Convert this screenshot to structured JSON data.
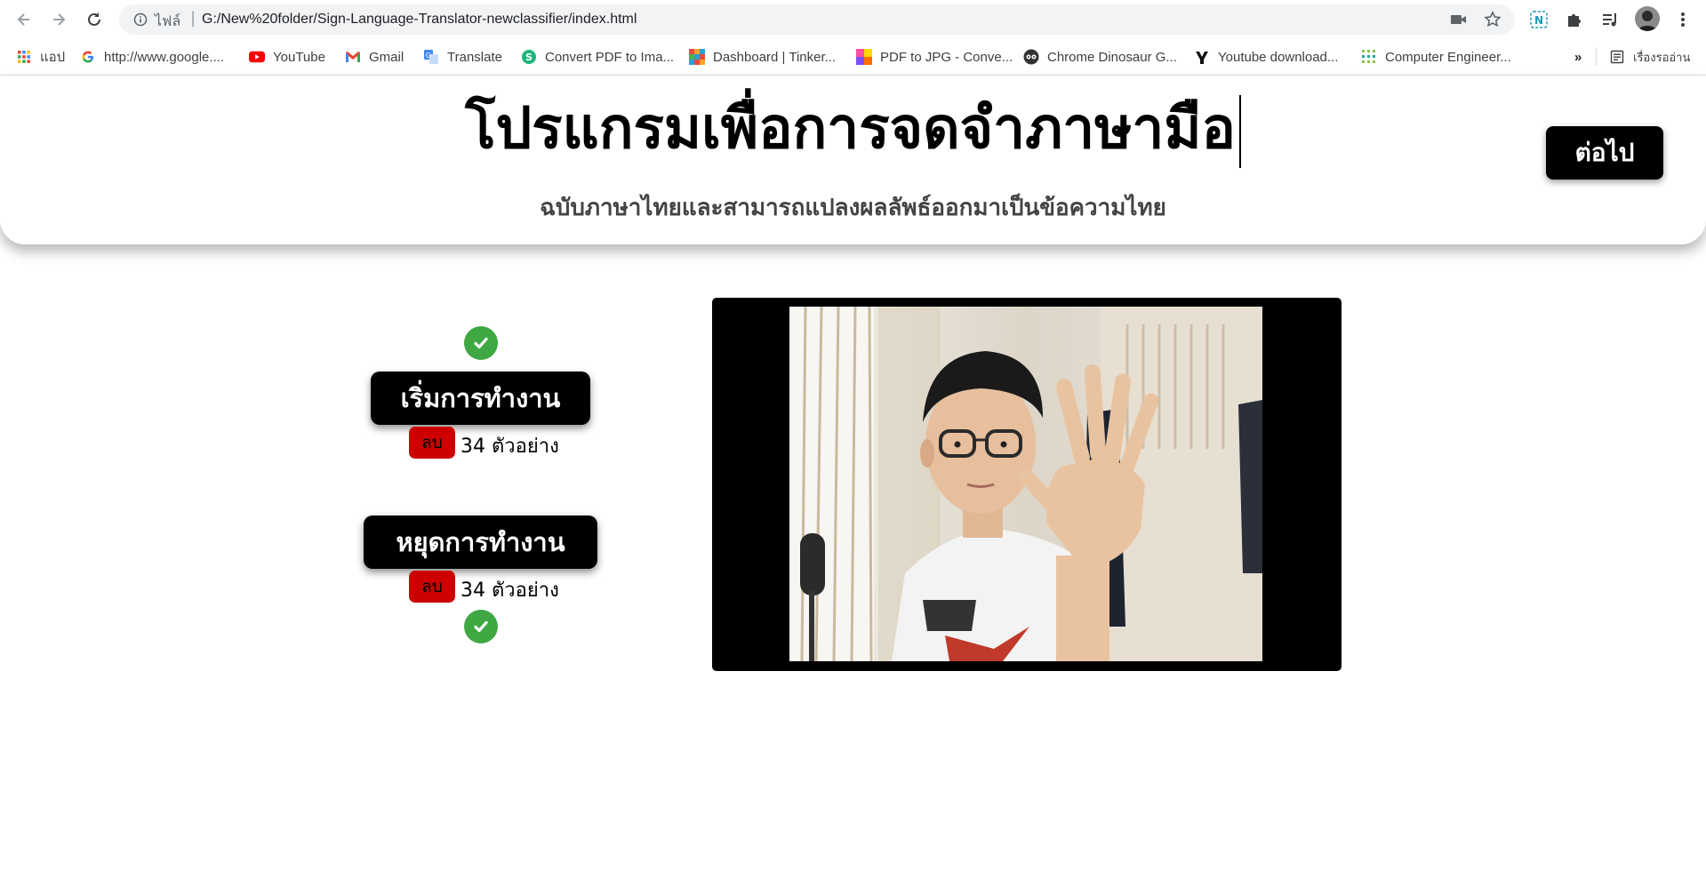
{
  "browser": {
    "scheme_label": "ไฟล์",
    "url": "G:/New%20folder/Sign-Language-Translator-newclassifier/index.html",
    "bookmarks": [
      {
        "label": "แอป",
        "icon": "apps-grid-icon"
      },
      {
        "label": "http://www.google....",
        "icon": "google-icon"
      },
      {
        "label": "YouTube",
        "icon": "youtube-icon"
      },
      {
        "label": "Gmail",
        "icon": "gmail-icon"
      },
      {
        "label": "Translate",
        "icon": "translate-icon"
      },
      {
        "label": "Convert PDF to Ima...",
        "icon": "convert-pdf-icon"
      },
      {
        "label": "Dashboard | Tinker...",
        "icon": "tinkercad-icon"
      },
      {
        "label": "PDF to JPG - Conve...",
        "icon": "pdf-to-jpg-icon"
      },
      {
        "label": "Chrome Dinosaur G...",
        "icon": "dinosaur-icon"
      },
      {
        "label": "Youtube download...",
        "icon": "youtube-download-icon"
      },
      {
        "label": "Computer Engineer...",
        "icon": "computer-engineer-icon"
      }
    ],
    "more_label": "»",
    "reading_list_label": "เรื่องรออ่าน"
  },
  "page": {
    "title": "โปรแกรมเพื่อการจดจำภาษามือ",
    "subtitle": "ฉบับภาษาไทยและสามารถแปลงผลลัพธ์ออกมาเป็นข้อความไทย",
    "next_label": "ต่อไป"
  },
  "controls": {
    "start": {
      "label": "เริ่มการทำงาน",
      "delete_label": "ลบ",
      "count": "34 ตัวอย่าง"
    },
    "stop": {
      "label": "หยุดการทำงาน",
      "delete_label": "ลบ",
      "count": "34 ตัวอย่าง"
    }
  },
  "colors": {
    "accent_green": "#3fa843",
    "delete_red": "#cc0000",
    "button_black": "#000000"
  }
}
